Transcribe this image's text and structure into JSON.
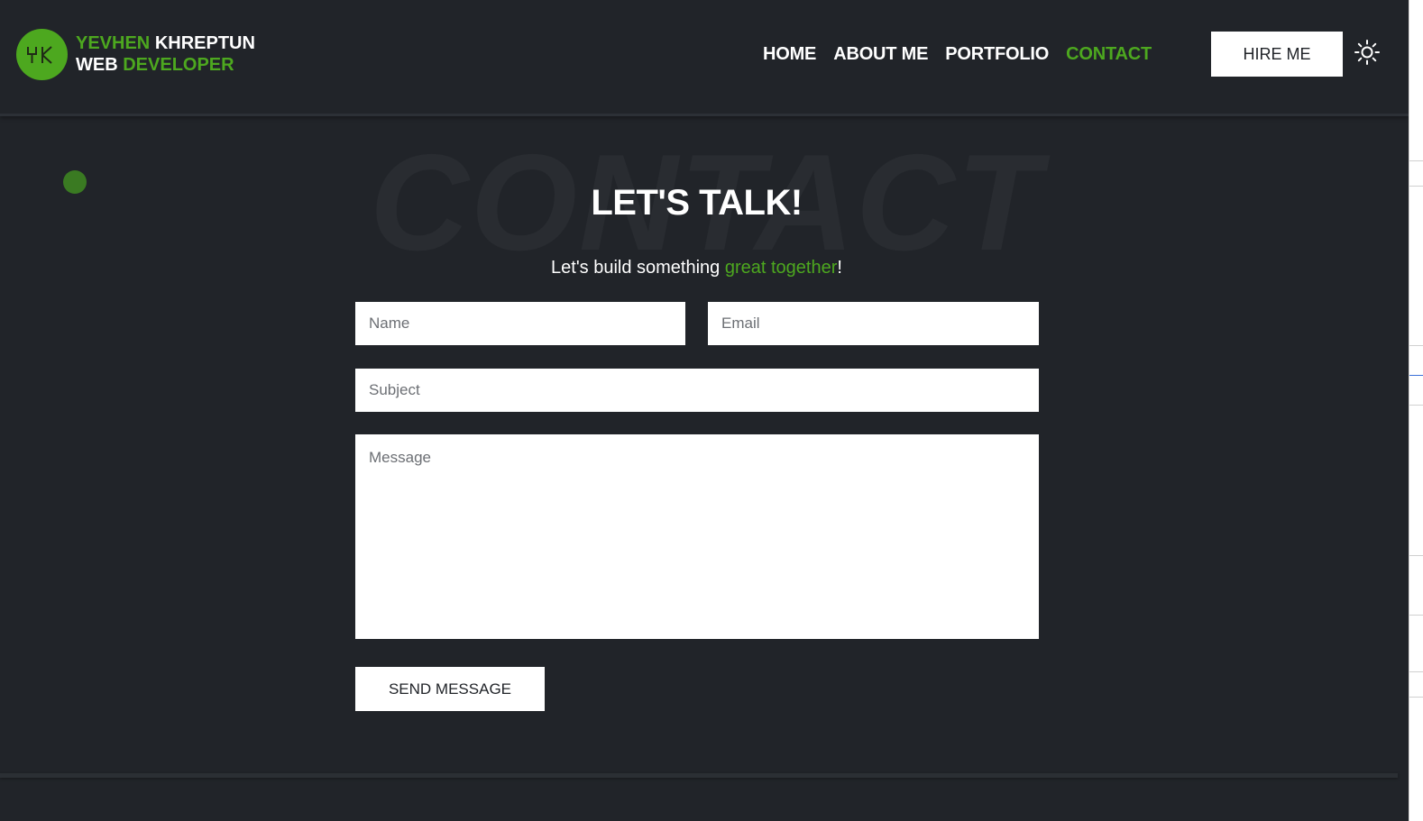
{
  "header": {
    "logo_initials_icon": "yk-monogram",
    "logo_line1_first": "YEVHEN",
    "logo_line1_last": "KHREPTUN",
    "logo_line2_first": "WEB",
    "logo_line2_last": "DEVELOPER",
    "nav": [
      {
        "label": "HOME",
        "active": false
      },
      {
        "label": "ABOUT ME",
        "active": false
      },
      {
        "label": "PORTFOLIO",
        "active": false
      },
      {
        "label": "CONTACT",
        "active": true
      }
    ],
    "hire_button": "HIRE ME",
    "theme_toggle_icon": "sun-icon"
  },
  "contact": {
    "background_word": "CONTACT",
    "title": "LET'S TALK!",
    "subtitle_start": "Let's build something ",
    "subtitle_highlight": "great together",
    "subtitle_end": "!",
    "form": {
      "name_placeholder": "Name",
      "email_placeholder": "Email",
      "subject_placeholder": "Subject",
      "message_placeholder": "Message",
      "submit_label": "SEND MESSAGE"
    }
  },
  "colors": {
    "background": "#212429",
    "accent": "#4da81f",
    "text": "#ffffff"
  }
}
